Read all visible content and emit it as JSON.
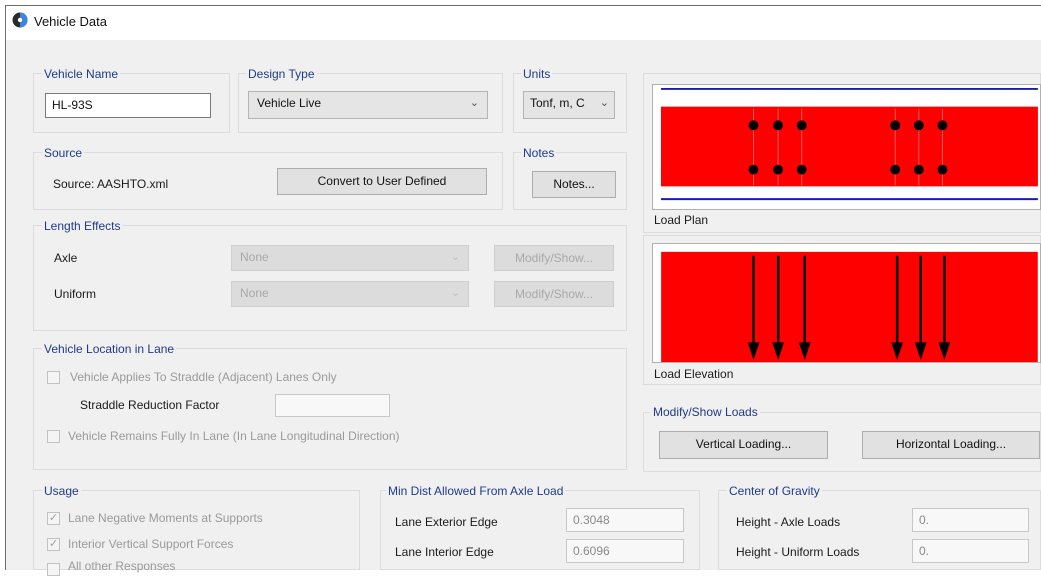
{
  "window": {
    "title": "Vehicle Data"
  },
  "vehicle_name": {
    "label": "Vehicle Name",
    "value": "HL-93S"
  },
  "design_type": {
    "label": "Design Type",
    "value": "Vehicle Live"
  },
  "units": {
    "label": "Units",
    "value": "Tonf, m, C"
  },
  "source": {
    "label": "Source",
    "text": "Source: AASHTO.xml",
    "convert_button": "Convert to User Defined"
  },
  "notes": {
    "label": "Notes",
    "button": "Notes..."
  },
  "length_effects": {
    "label": "Length Effects",
    "axle": {
      "label": "Axle",
      "value": "None",
      "button": "Modify/Show..."
    },
    "uniform": {
      "label": "Uniform",
      "value": "None",
      "button": "Modify/Show..."
    }
  },
  "vehicle_location": {
    "label": "Vehicle Location in Lane",
    "straddle_check": "Vehicle Applies To Straddle (Adjacent) Lanes Only",
    "straddle_factor_label": "Straddle Reduction Factor",
    "straddle_factor_value": "",
    "fully_in_lane_check": "Vehicle Remains Fully In Lane (In Lane Longitudinal Direction)"
  },
  "load_plan": {
    "caption": "Load Plan"
  },
  "load_elevation": {
    "caption": "Load Elevation"
  },
  "modify_show_loads": {
    "label": "Modify/Show Loads",
    "vertical_button": "Vertical Loading...",
    "horizontal_button": "Horizontal Loading..."
  },
  "usage": {
    "label": "Usage",
    "items": [
      "Lane Negative Moments at Supports",
      "Interior Vertical Support Forces",
      "All other Responses"
    ]
  },
  "min_dist": {
    "label": "Min Dist Allowed From Axle Load",
    "exterior_label": "Lane Exterior Edge",
    "exterior_value": "0.3048",
    "interior_label": "Lane Interior Edge",
    "interior_value": "0.6096"
  },
  "center_of_gravity": {
    "label": "Center of Gravity",
    "axle_label": "Height - Axle Loads",
    "axle_value": "0.",
    "uniform_label": "Height - Uniform Loads",
    "uniform_value": "0."
  },
  "colors": {
    "load_fill": "#ff0000",
    "lane_line": "#1c1cb4",
    "group_label": "#1f3a8a"
  }
}
